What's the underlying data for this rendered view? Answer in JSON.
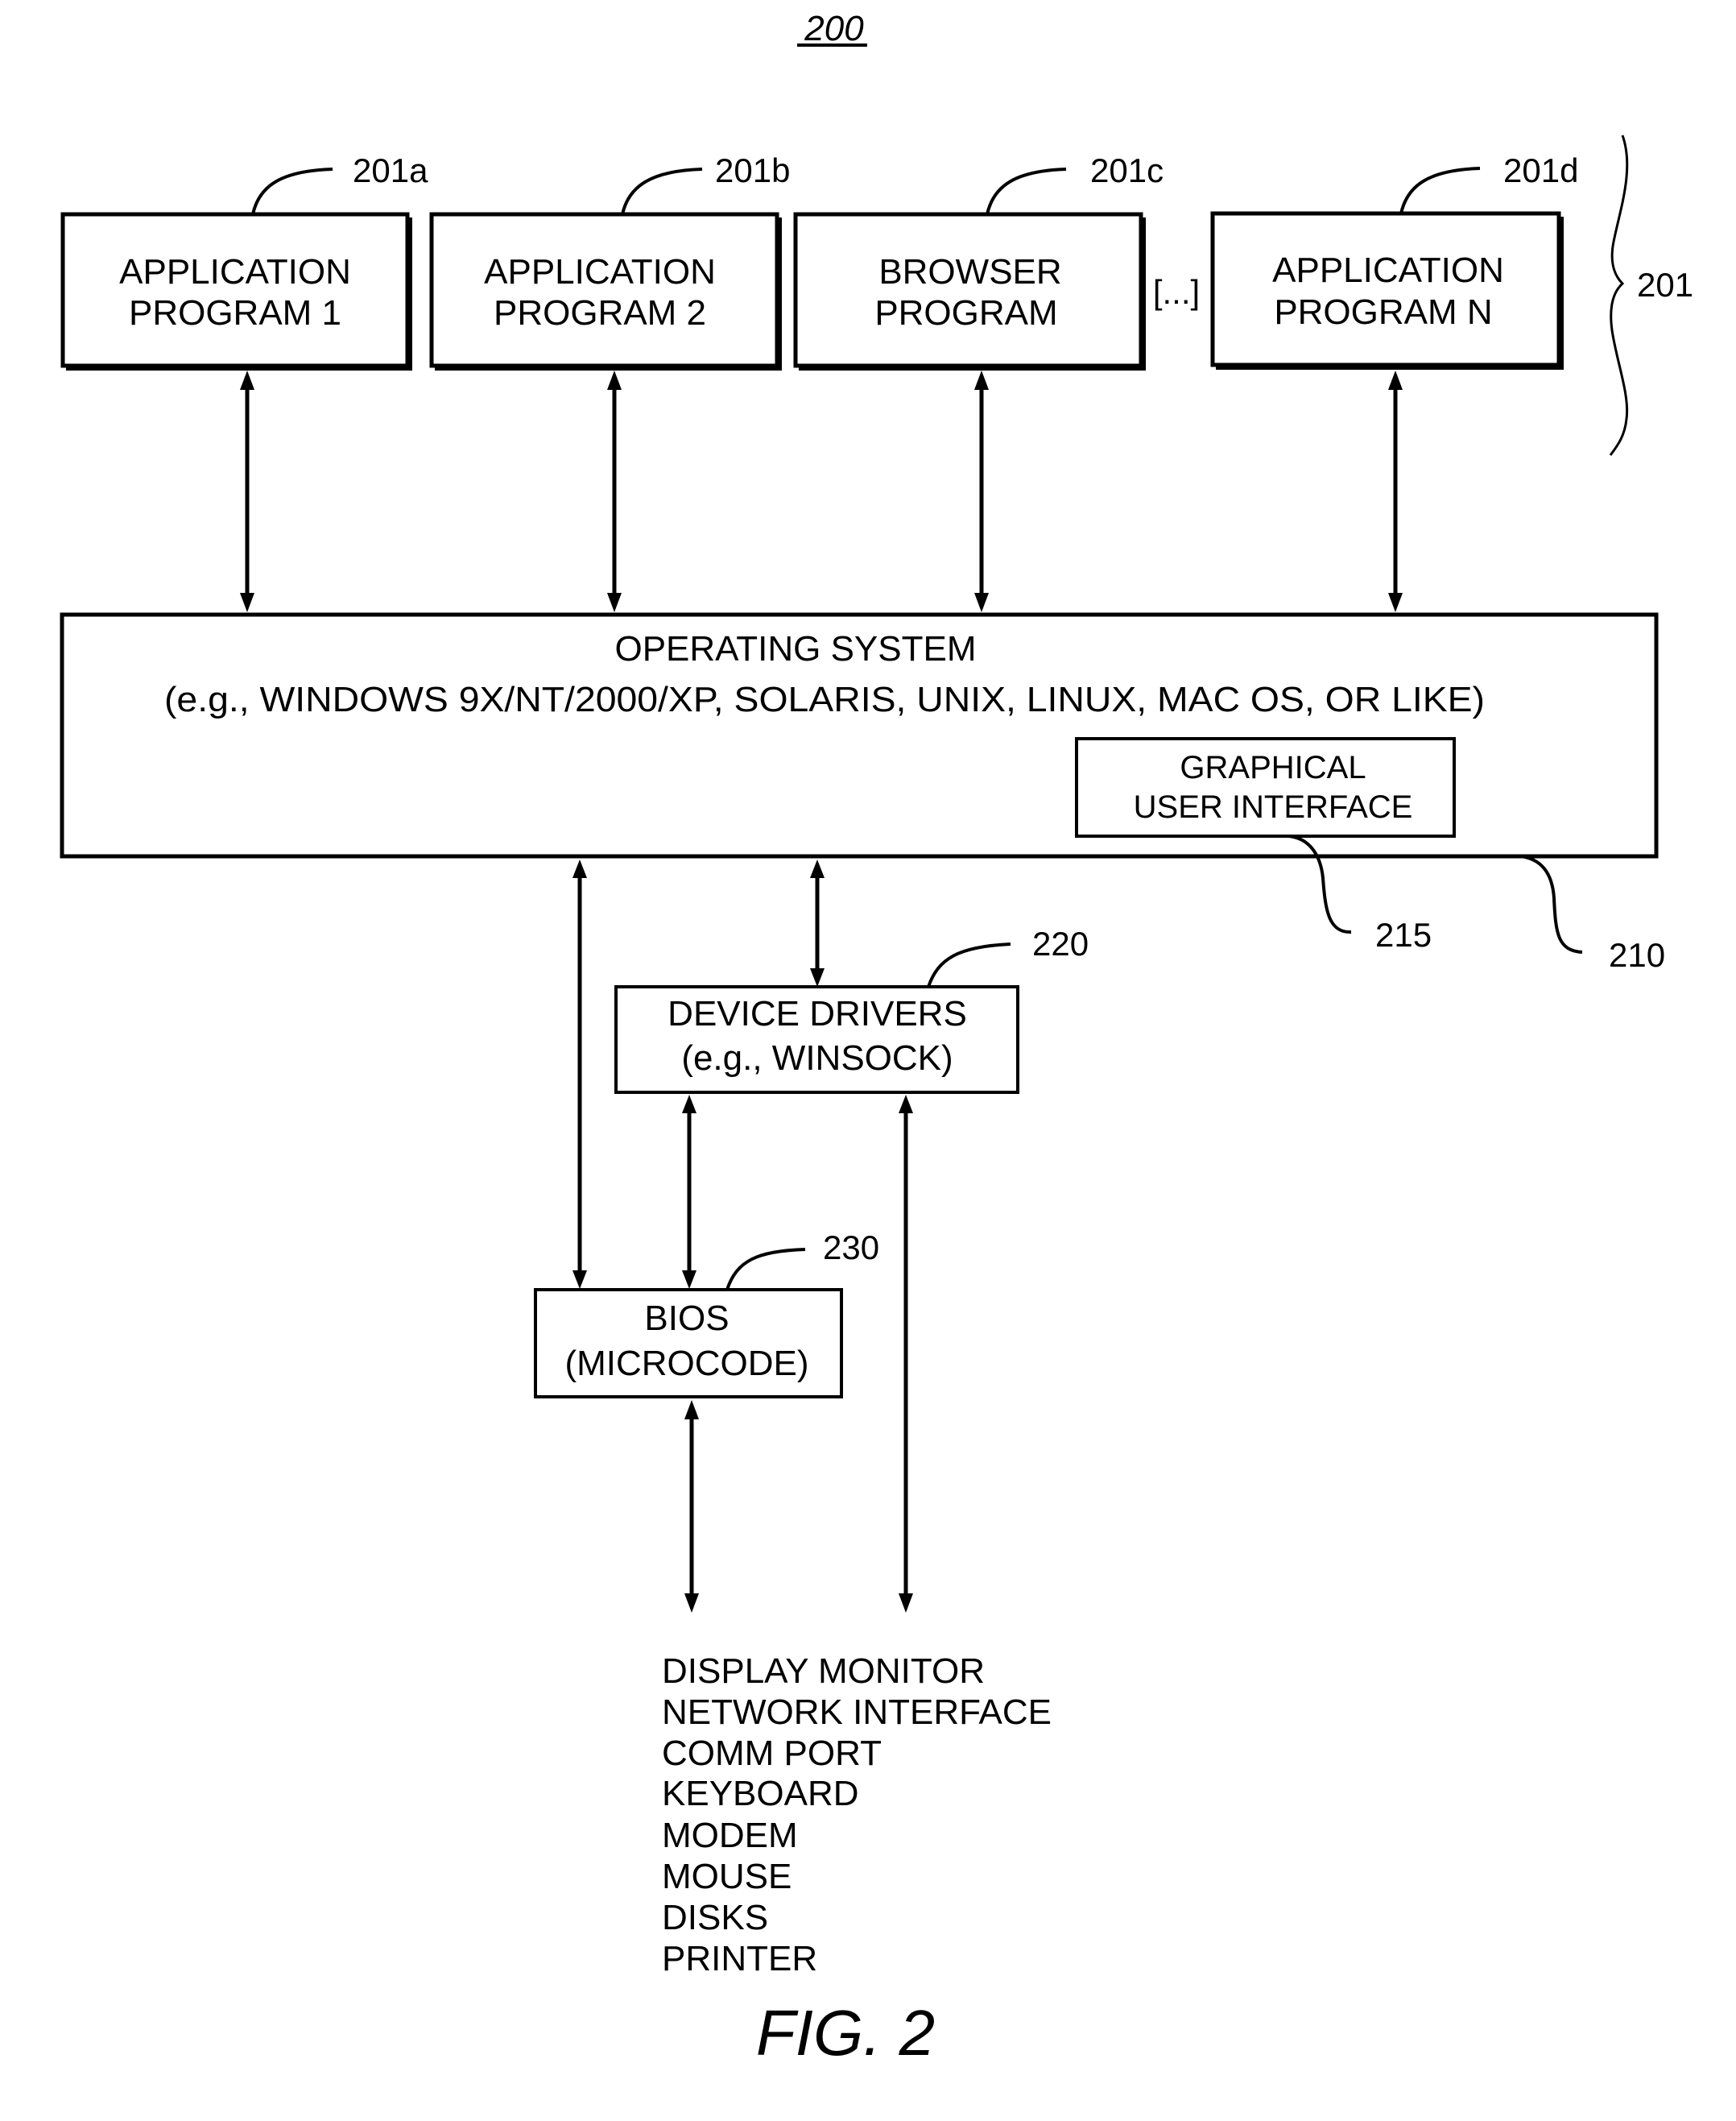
{
  "figure": {
    "ref_number": "200",
    "caption": "FIG. 2"
  },
  "applications": {
    "group_ref": "201",
    "separator": "[...]",
    "items": [
      {
        "ref": "201a",
        "line1": "APPLICATION",
        "line2": "PROGRAM 1"
      },
      {
        "ref": "201b",
        "line1": "APPLICATION",
        "line2": "PROGRAM 2"
      },
      {
        "ref": "201c",
        "line1": "BROWSER",
        "line2": "PROGRAM"
      },
      {
        "ref": "201d",
        "line1": "APPLICATION",
        "line2": "PROGRAM N"
      }
    ]
  },
  "operating_system": {
    "ref": "210",
    "title": "OPERATING SYSTEM",
    "examples": "(e.g., WINDOWS 9X/NT/2000/XP, SOLARIS, UNIX, LINUX, MAC OS, OR LIKE)",
    "gui": {
      "ref": "215",
      "line1": "GRAPHICAL",
      "line2": "USER INTERFACE"
    }
  },
  "device_drivers": {
    "ref": "220",
    "line1": "DEVICE DRIVERS",
    "line2": "(e.g., WINSOCK)"
  },
  "bios": {
    "ref": "230",
    "line1": "BIOS",
    "line2": "(MICROCODE)"
  },
  "devices": [
    "DISPLAY MONITOR",
    "NETWORK INTERFACE",
    "COMM PORT",
    "KEYBOARD",
    "MODEM",
    "MOUSE",
    "DISKS",
    "PRINTER"
  ]
}
